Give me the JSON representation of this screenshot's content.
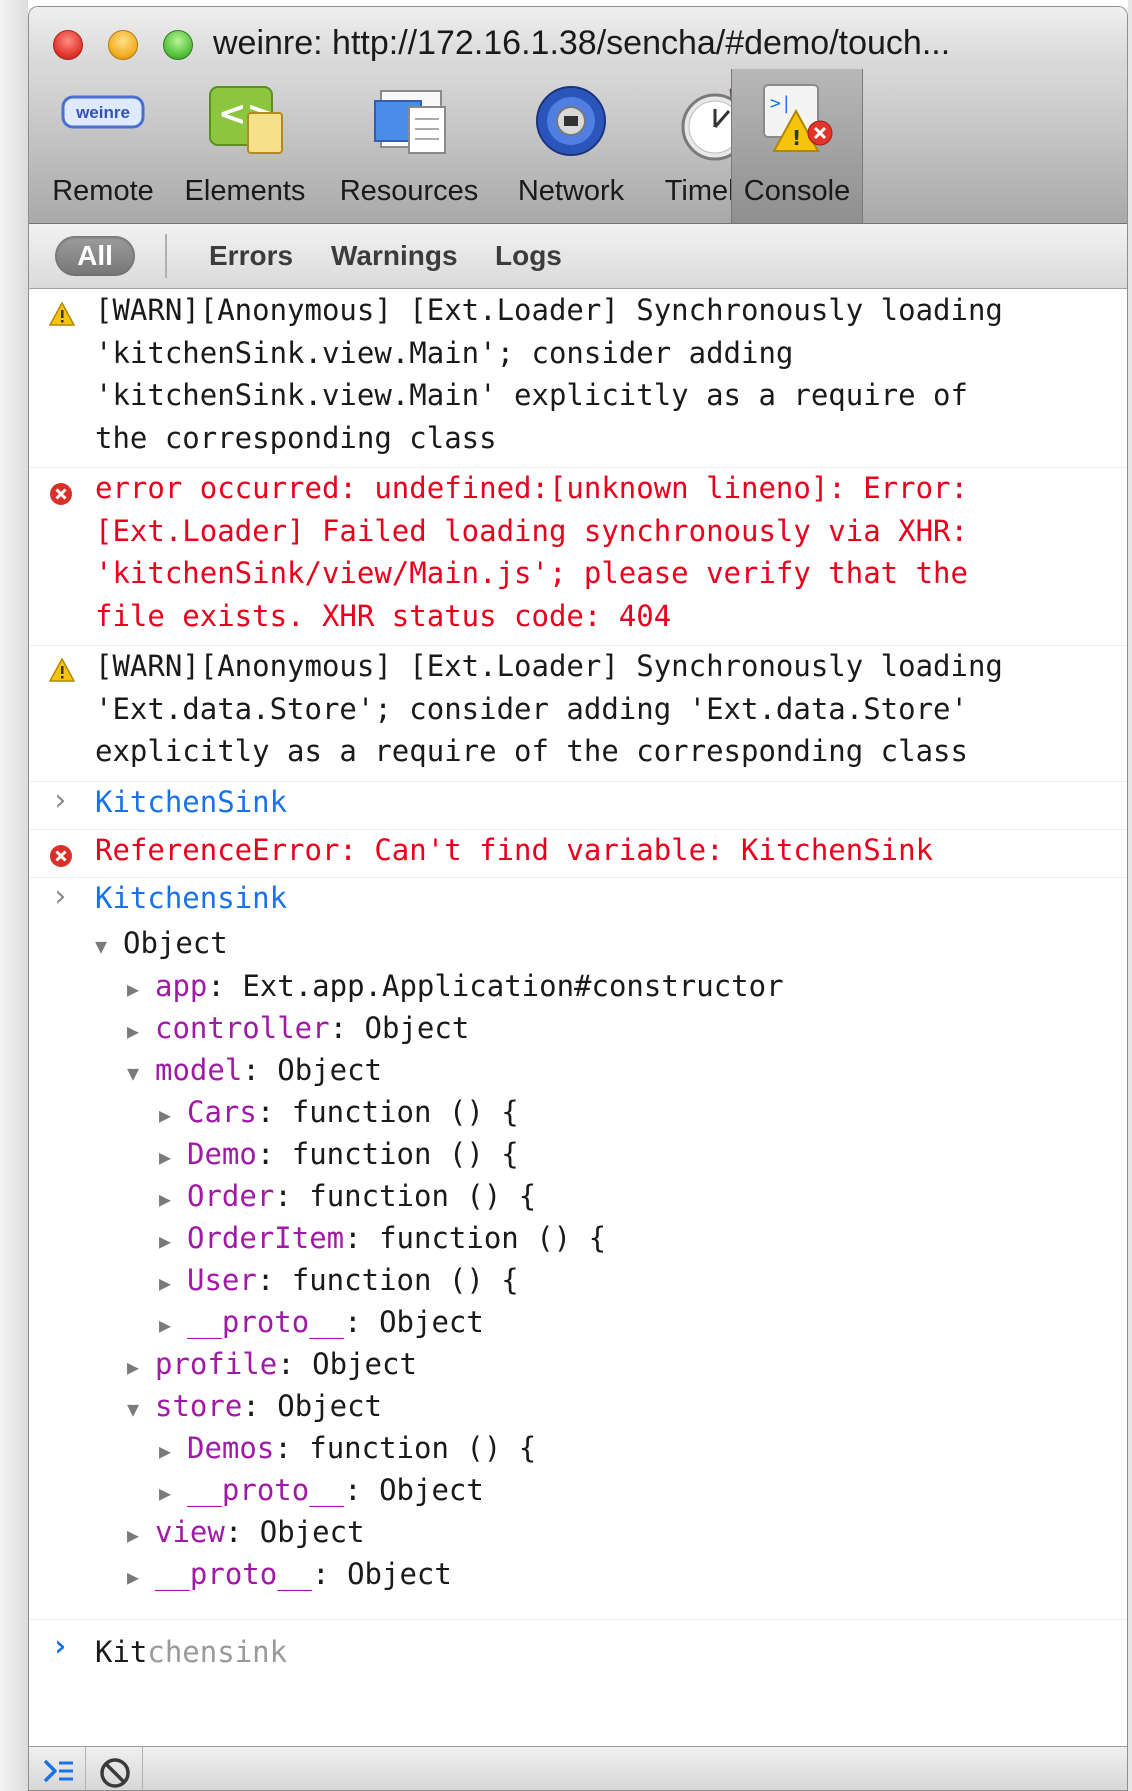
{
  "window": {
    "title": "weinre: http://172.16.1.38/sencha/#demo/touch..."
  },
  "toolbar": {
    "tabs": [
      {
        "label": "Remote",
        "icon": "weinre-icon"
      },
      {
        "label": "Elements",
        "icon": "elements-icon"
      },
      {
        "label": "Resources",
        "icon": "resources-icon"
      },
      {
        "label": "Network",
        "icon": "network-icon"
      },
      {
        "label": "Timeline",
        "icon": "timeline-icon"
      },
      {
        "label": "Console",
        "icon": "console-icon",
        "selected": true
      }
    ],
    "remote_badge": "weinre"
  },
  "filters": {
    "all": "All",
    "errors": "Errors",
    "warnings": "Warnings",
    "logs": "Logs"
  },
  "console": {
    "messages": [
      {
        "level": "warning",
        "text": "[WARN][Anonymous] [Ext.Loader] Synchronously loading\n'kitchenSink.view.Main'; consider adding\n'kitchenSink.view.Main' explicitly as a require of\nthe corresponding class"
      },
      {
        "level": "error",
        "text": "error occurred: undefined:[unknown lineno]: Error:\n[Ext.Loader] Failed loading synchronously via XHR:\n'kitchenSink/view/Main.js'; please verify that the\nfile exists. XHR status code: 404"
      },
      {
        "level": "warning",
        "text": "[WARN][Anonymous] [Ext.Loader] Synchronously loading\n'Ext.data.Store'; consider adding 'Ext.data.Store'\nexplicitly as a require of the corresponding class"
      },
      {
        "level": "input",
        "text": "KitchenSink"
      },
      {
        "level": "error",
        "text": "ReferenceError: Can't find variable: KitchenSink"
      },
      {
        "level": "input",
        "text": "Kitchensink"
      }
    ],
    "tree": {
      "root": "Object",
      "rows": [
        {
          "key": "app",
          "value": "Ext.app.Application#constructor"
        },
        {
          "key": "controller",
          "value": "Object"
        },
        {
          "key": "model",
          "value": "Object"
        },
        {
          "key": "Cars",
          "value": "function () {"
        },
        {
          "key": "Demo",
          "value": "function () {"
        },
        {
          "key": "Order",
          "value": "function () {"
        },
        {
          "key": "OrderItem",
          "value": "function () {"
        },
        {
          "key": "User",
          "value": "function () {"
        },
        {
          "key": "__proto__",
          "value": "Object"
        },
        {
          "key": "profile",
          "value": "Object"
        },
        {
          "key": "store",
          "value": "Object"
        },
        {
          "key": "Demos",
          "value": "function () {"
        },
        {
          "key": "__proto__",
          "value": "Object"
        },
        {
          "key": "view",
          "value": "Object"
        },
        {
          "key": "__proto__",
          "value": "Object"
        }
      ]
    },
    "prompt": {
      "typed": "Kit",
      "autocomplete_hint": "chensink"
    }
  },
  "colors": {
    "error": "#e8001c",
    "input": "#1a72e8",
    "property_key": "#a01aa6",
    "warning": "#f2b400"
  }
}
